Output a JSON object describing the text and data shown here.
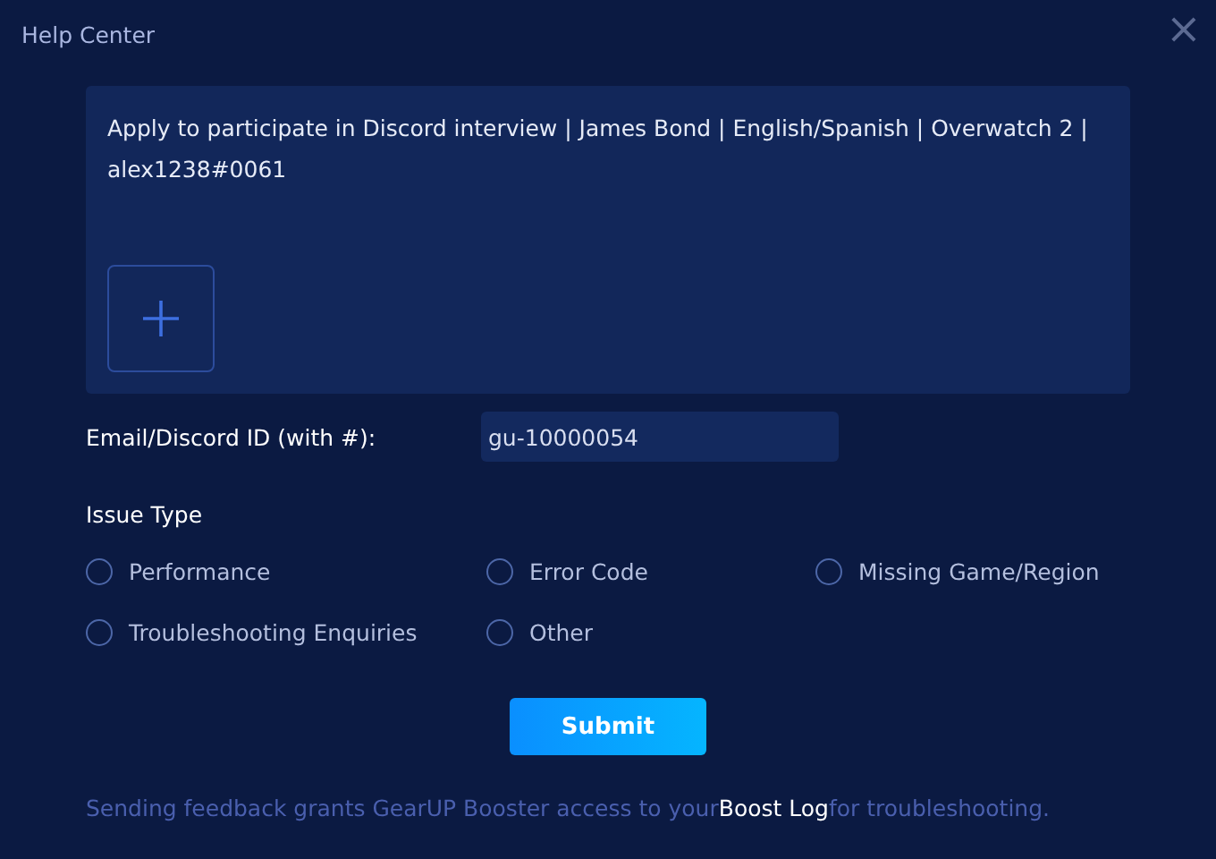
{
  "window": {
    "title": "Help Center",
    "close_glyph": "×"
  },
  "message": {
    "value": "Apply to participate in Discord interview | James Bond | English/Spanish | Overwatch 2 | alex1238#0061"
  },
  "contact": {
    "label": "Email/Discord ID (with #):",
    "value": "gu-10000054"
  },
  "issue_type": {
    "label": "Issue Type",
    "options": [
      {
        "label": "Performance",
        "selected": false
      },
      {
        "label": "Error Code",
        "selected": false
      },
      {
        "label": "Missing Game/Region",
        "selected": false
      },
      {
        "label": "Troubleshooting Enquiries",
        "selected": false
      },
      {
        "label": "Other",
        "selected": false
      }
    ]
  },
  "submit": {
    "label": "Submit"
  },
  "footer": {
    "before": "Sending feedback grants GearUP Booster access to your",
    "link": "Boost Log",
    "after": "for troubleshooting."
  }
}
